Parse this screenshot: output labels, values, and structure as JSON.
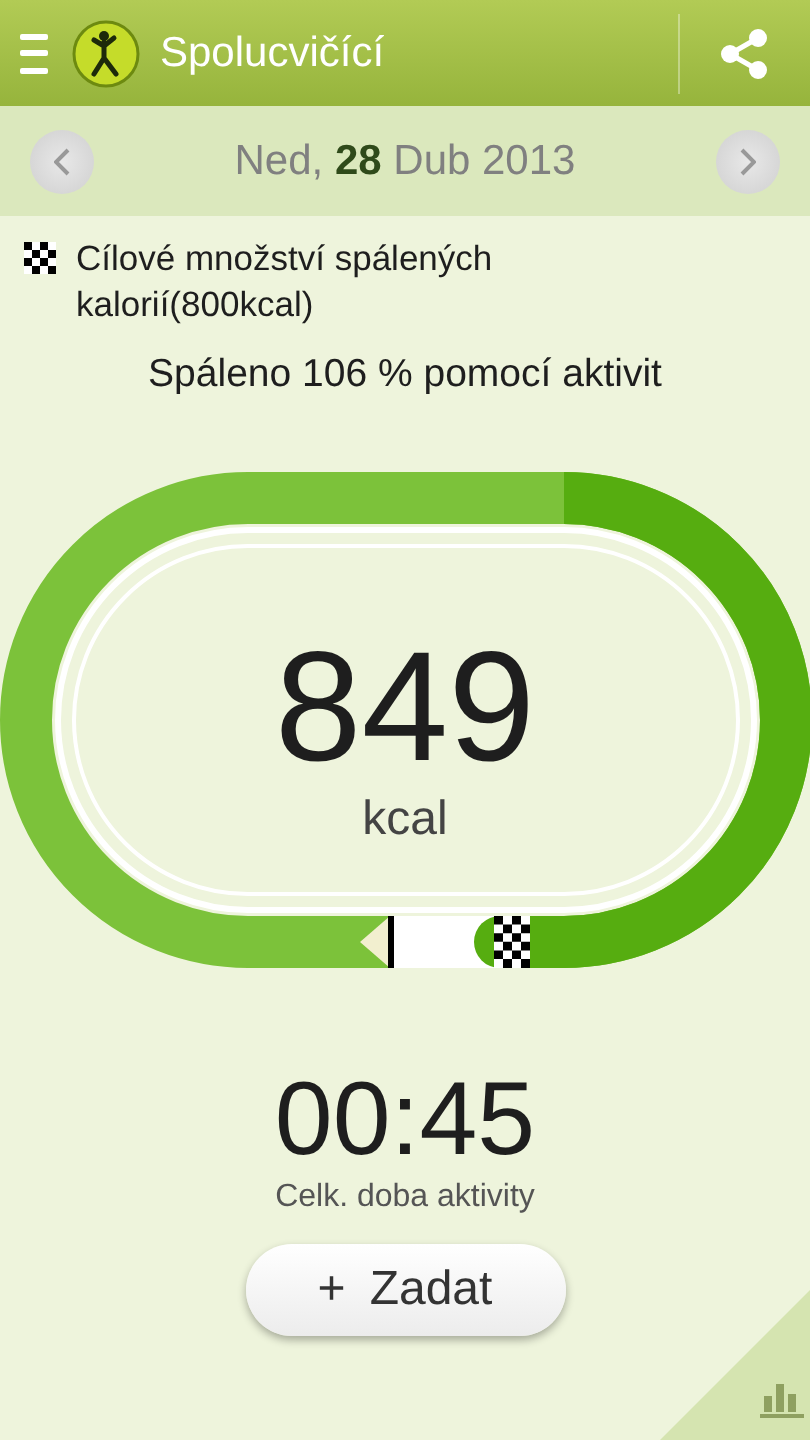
{
  "app_bar": {
    "title": "Spolucvičící"
  },
  "date_bar": {
    "day_name": "Ned,",
    "day": "28",
    "month_year": "Dub 2013"
  },
  "goal": {
    "text": "Cílové množství spálených kalorií(800kcal)"
  },
  "summary": "Spáleno 106 % pomocí aktivit",
  "calories": {
    "value": "849",
    "unit": "kcal"
  },
  "duration": {
    "value": "00:45",
    "label": "Celk. doba aktivity"
  },
  "add_button": {
    "icon": "+",
    "label": "Zadat"
  }
}
